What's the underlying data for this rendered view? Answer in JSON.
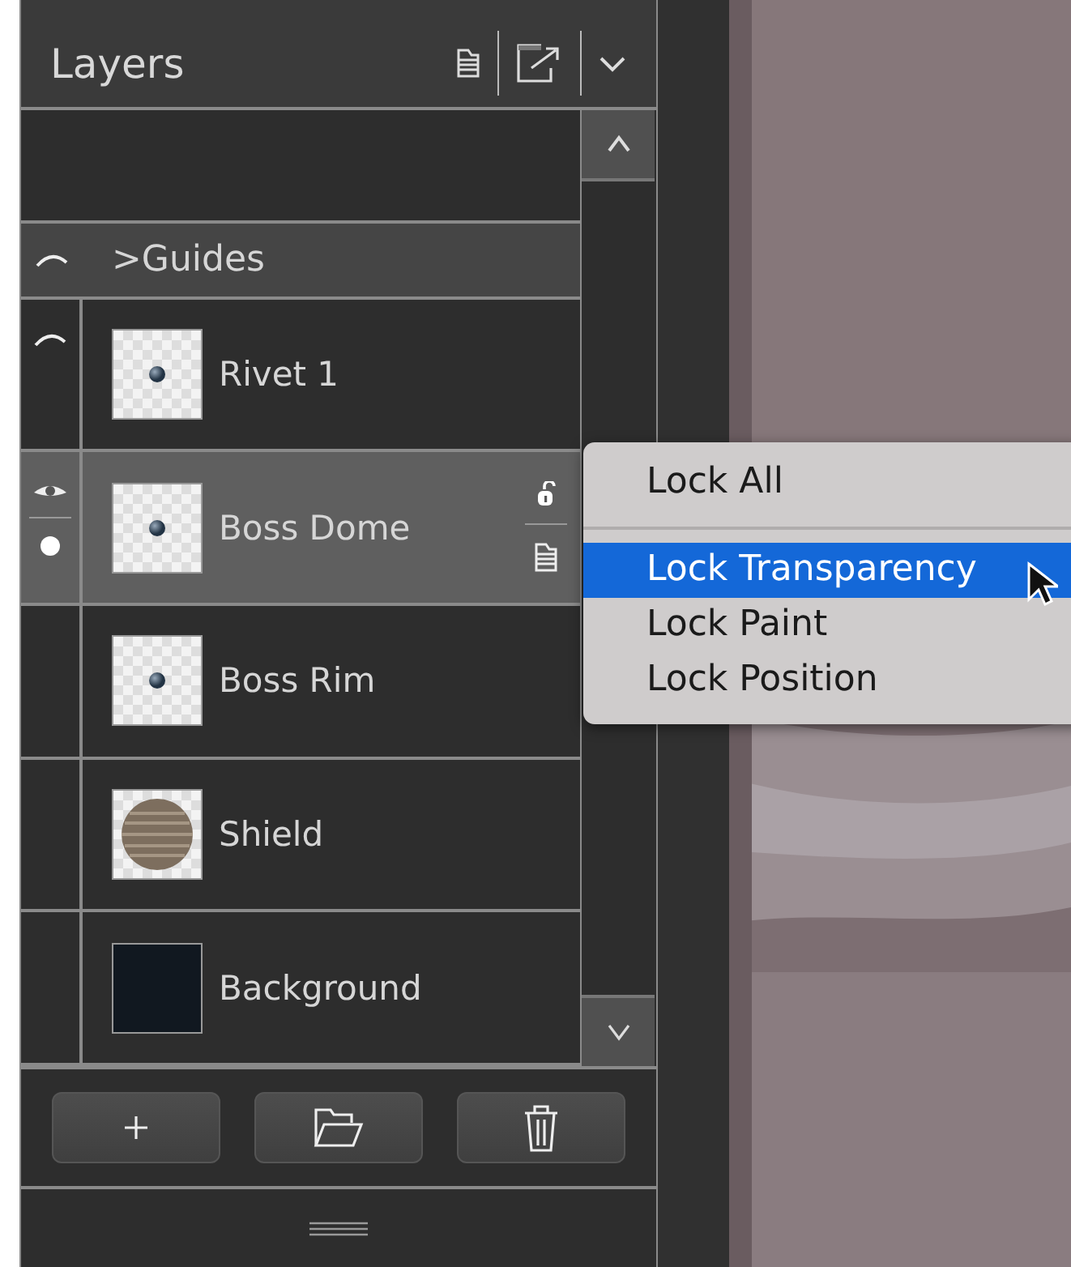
{
  "panel": {
    "title": "Layers"
  },
  "layers": [
    {
      "kind": "group",
      "name": ">Guides",
      "hidden": true,
      "selected": false
    },
    {
      "kind": "layer",
      "name": "Rivet 1",
      "thumbnail": {
        "kind": "dot"
      },
      "hidden": true,
      "selected": false
    },
    {
      "kind": "layer",
      "name": "Boss Dome",
      "thumbnail": {
        "kind": "dot"
      },
      "hidden": false,
      "selected": true
    },
    {
      "kind": "layer",
      "name": "Boss Rim",
      "thumbnail": {
        "kind": "dot"
      },
      "hidden": false,
      "selected": false
    },
    {
      "kind": "layer",
      "name": "Shield",
      "thumbnail": {
        "kind": "wood"
      },
      "hidden": false,
      "selected": false
    },
    {
      "kind": "layer",
      "name": "Background",
      "thumbnail": {
        "kind": "solid"
      },
      "hidden": false,
      "selected": false
    }
  ],
  "lock_menu": [
    {
      "label": "Lock All",
      "selected": false,
      "separator_after": true
    },
    {
      "label": "Lock Transparency",
      "selected": true,
      "separator_after": false
    },
    {
      "label": "Lock Paint",
      "selected": false,
      "separator_after": false
    },
    {
      "label": "Lock Position",
      "selected": false,
      "separator_after": false
    }
  ]
}
